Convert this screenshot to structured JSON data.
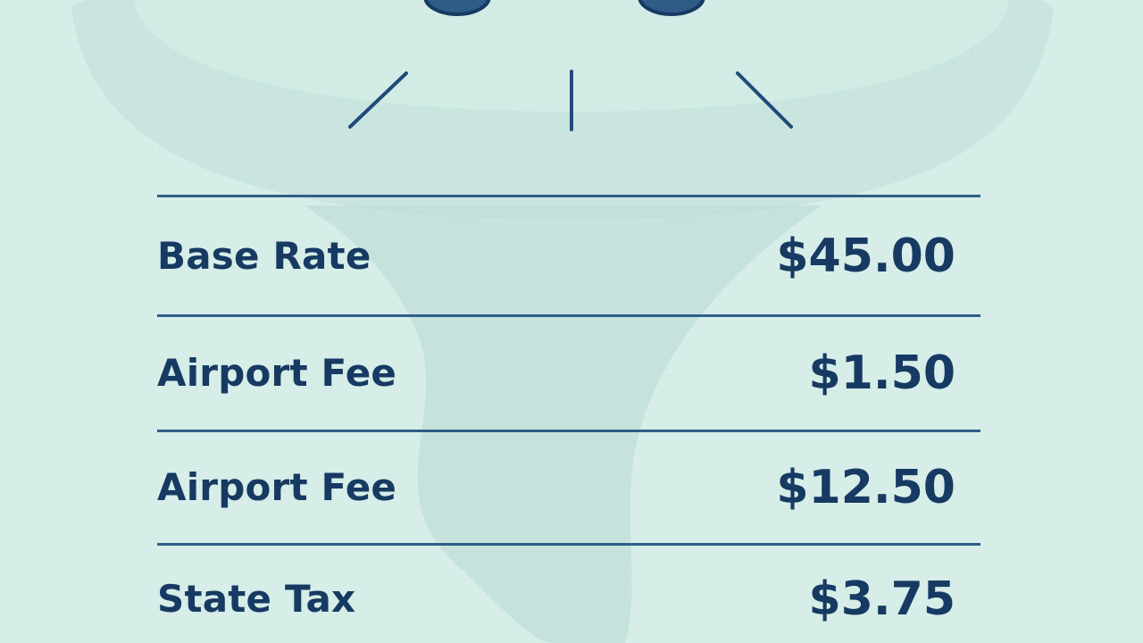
{
  "colors": {
    "background": "#d6ede8",
    "text": "#173a63",
    "rule": "#2f5f86"
  },
  "fees": {
    "rows": [
      {
        "label": "Base Rate",
        "amount": "$45.00"
      },
      {
        "label": "Airport Fee",
        "amount": "$1.50"
      },
      {
        "label": "Airport Fee",
        "amount": "$12.50"
      },
      {
        "label": "State Tax",
        "amount": "$3.75"
      }
    ]
  }
}
